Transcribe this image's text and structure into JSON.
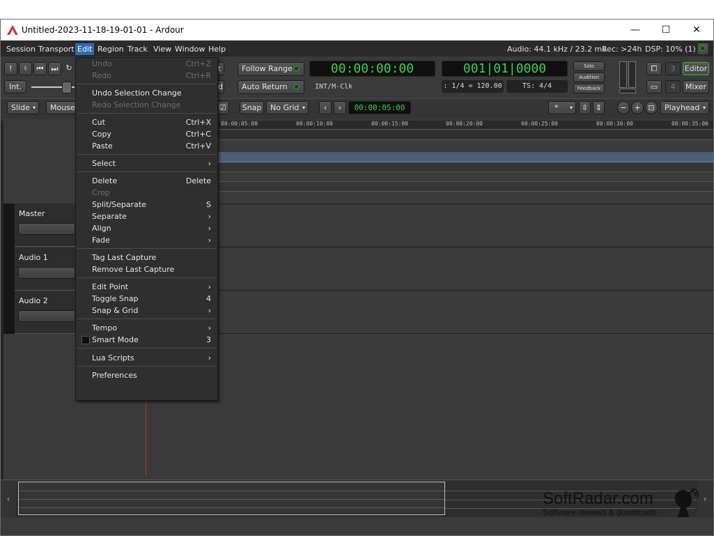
{
  "window": {
    "title": "Untitled-2023-11-18-19-01-01 - Ardour",
    "controls": [
      "—",
      "☐",
      "✕"
    ]
  },
  "menubar": {
    "items": [
      "Session",
      "Transport",
      "Edit",
      "Region",
      "Track",
      "View",
      "Window",
      "Help"
    ],
    "status_audio": "Audio: 44.1 kHz / 23.2 ms",
    "status_rec": "Rec: >24h",
    "status_dsp": "DSP: 10% (1)"
  },
  "toolbar": {
    "int_label": "Int.",
    "follow_range": "Follow Range",
    "auto_return": "Auto Return",
    "primary_clock": "00:00:00:00",
    "secondary_clock": "001|01|0000",
    "clock_source": "INT/M-Clk",
    "tempo": ": 1/4 = 120.00",
    "ts": "TS: 4/4",
    "solo": "Solo",
    "audition": "Audition",
    "feedback": "Feedback",
    "editor_btn": "Editor",
    "mixer_btn": "Mixer",
    "num3": "3",
    "num4": "4",
    "partial_t": "t",
    "partial_d": "d"
  },
  "editbar": {
    "slide": "Slide",
    "mouse": "Mouse",
    "snap": "Snap",
    "grid": "No Grid",
    "nudge_clock": "00:00:05:00",
    "zoom_select": "*",
    "playhead": "Playhead"
  },
  "ruler": {
    "labels": [
      "00:00:05:00",
      "00:00:10:00",
      "00:00:15:00",
      "00:00:20:00",
      "00:00:25:00",
      "00:00:30:00",
      "00:00:35:00"
    ]
  },
  "tracks": [
    {
      "name": "Master"
    },
    {
      "name": "Audio  1"
    },
    {
      "name": "Audio  2"
    }
  ],
  "edit_menu": {
    "items": [
      {
        "label": "Undo",
        "shortcut": "Ctrl+Z",
        "disabled": true
      },
      {
        "label": "Redo",
        "shortcut": "Ctrl+R",
        "disabled": true
      },
      {
        "label": "Undo Selection Change",
        "shortcut": "",
        "disabled": false
      },
      {
        "label": "Redo Selection Change",
        "shortcut": "",
        "disabled": true
      },
      {
        "label": "Cut",
        "shortcut": "Ctrl+X",
        "disabled": false
      },
      {
        "label": "Copy",
        "shortcut": "Ctrl+C",
        "disabled": false
      },
      {
        "label": "Paste",
        "shortcut": "Ctrl+V",
        "disabled": false
      },
      {
        "label": "Select",
        "shortcut": "›",
        "disabled": false
      },
      {
        "label": "Delete",
        "shortcut": "Delete",
        "disabled": false
      },
      {
        "label": "Crop",
        "shortcut": "",
        "disabled": true
      },
      {
        "label": "Split/Separate",
        "shortcut": "S",
        "disabled": false
      },
      {
        "label": "Separate",
        "shortcut": "›",
        "disabled": false
      },
      {
        "label": "Align",
        "shortcut": "›",
        "disabled": false
      },
      {
        "label": "Fade",
        "shortcut": "›",
        "disabled": false
      },
      {
        "label": "Tag Last Capture",
        "shortcut": "",
        "disabled": false
      },
      {
        "label": "Remove Last Capture",
        "shortcut": "",
        "disabled": false
      },
      {
        "label": "Edit Point",
        "shortcut": "›",
        "disabled": false
      },
      {
        "label": "Toggle Snap",
        "shortcut": "4",
        "disabled": false
      },
      {
        "label": "Snap & Grid",
        "shortcut": "›",
        "disabled": false
      },
      {
        "label": "Tempo",
        "shortcut": "›",
        "disabled": false
      },
      {
        "label": "Smart Mode",
        "shortcut": "3",
        "disabled": false
      },
      {
        "label": "Lua Scripts",
        "shortcut": "›",
        "disabled": false
      },
      {
        "label": "Preferences",
        "shortcut": "",
        "disabled": false
      }
    ]
  },
  "watermark": {
    "brand": "SoftRadar.com",
    "tagline": "Software reviews & downloads"
  },
  "colors": {
    "accent": "#2f6bb0",
    "clock_green": "#39d24b",
    "playhead": "#c62828"
  }
}
